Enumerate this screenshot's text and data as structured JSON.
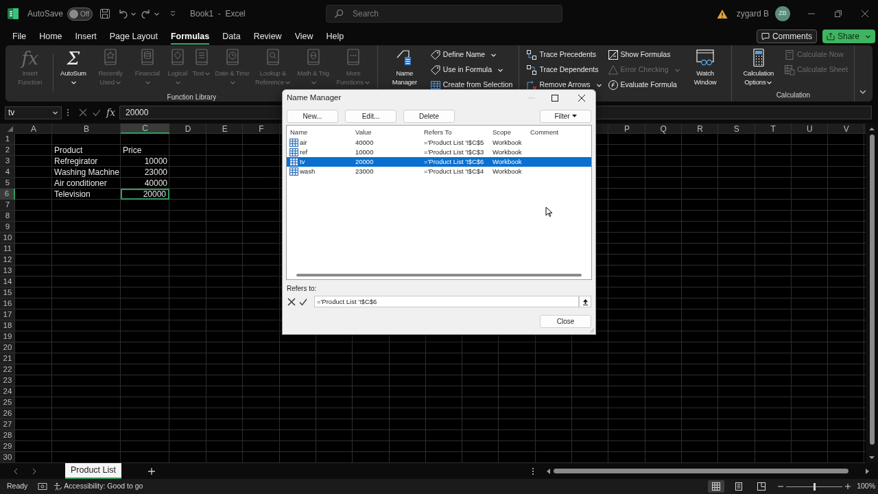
{
  "title_bar": {
    "autosave": {
      "label": "AutoSave",
      "on": false,
      "state": "Off"
    },
    "document_title": "Book1  -  Excel",
    "search": {
      "placeholder": "Search"
    },
    "user": {
      "name": "zygard B",
      "initials": "ZB"
    }
  },
  "menu": {
    "tabs": [
      {
        "label": "File",
        "selected": false
      },
      {
        "label": "Home",
        "selected": false
      },
      {
        "label": "Insert",
        "selected": false
      },
      {
        "label": "Page Layout",
        "selected": false
      },
      {
        "label": "Formulas",
        "selected": true
      },
      {
        "label": "Data",
        "selected": false
      },
      {
        "label": "Review",
        "selected": false
      },
      {
        "label": "View",
        "selected": false
      },
      {
        "label": "Help",
        "selected": false
      }
    ],
    "comments_button": "Comments",
    "share_button": "Share"
  },
  "ribbon": {
    "groups": [
      {
        "label": "Function Library",
        "items": [
          {
            "kind": "large",
            "glyph": "fx",
            "label": "Insert Function",
            "disabled": true,
            "dropdown": false
          },
          {
            "kind": "divider"
          },
          {
            "kind": "large",
            "glyph": "Σ",
            "label": "AutoSum",
            "disabled": false,
            "dropdown": true
          },
          {
            "kind": "large",
            "label": "Recently Used",
            "disabled": true,
            "dropdown": true
          },
          {
            "kind": "large",
            "label": "Financial",
            "disabled": true,
            "dropdown": true
          },
          {
            "kind": "large",
            "label": "Logical",
            "disabled": true,
            "dropdown": true
          },
          {
            "kind": "large",
            "label": "Text",
            "disabled": true,
            "dropdown": true
          },
          {
            "kind": "large",
            "label": "Date & Time",
            "disabled": true,
            "dropdown": true
          },
          {
            "kind": "large",
            "label": "Lookup & Reference",
            "disabled": true,
            "dropdown": true
          },
          {
            "kind": "large",
            "label": "Math & Trig",
            "disabled": true,
            "dropdown": true
          },
          {
            "kind": "large",
            "label": "More Functions",
            "disabled": true,
            "dropdown": true
          }
        ]
      },
      {
        "items": [
          {
            "kind": "large",
            "label": "Name Manager",
            "disabled": false,
            "dropdown": false
          },
          {
            "kind": "stack",
            "items": [
              {
                "label": "Define Name",
                "disabled": false,
                "dropdown": true
              },
              {
                "label": "Use in Formula",
                "disabled": false,
                "dropdown": true
              },
              {
                "label": "Create from Selection",
                "disabled": false,
                "dropdown": false
              }
            ]
          }
        ]
      },
      {
        "items": [
          {
            "kind": "stack",
            "items": [
              {
                "label": "Trace Precedents",
                "disabled": false,
                "dropdown": false
              },
              {
                "label": "Trace Dependents",
                "disabled": false,
                "dropdown": false
              },
              {
                "label": "Remove Arrows",
                "disabled": false,
                "dropdown": true
              }
            ]
          },
          {
            "kind": "stack",
            "items": [
              {
                "label": "Show Formulas",
                "disabled": false,
                "dropdown": false
              },
              {
                "label": "Error Checking",
                "disabled": true,
                "dropdown": true
              },
              {
                "label": "Evaluate Formula",
                "disabled": false,
                "dropdown": false
              }
            ]
          },
          {
            "kind": "large",
            "label": "Watch Window",
            "disabled": false,
            "dropdown": false
          }
        ]
      },
      {
        "label": "Calculation",
        "items": [
          {
            "kind": "large",
            "label": "Calculation Options",
            "disabled": false,
            "dropdown": true
          },
          {
            "kind": "stack",
            "items": [
              {
                "label": "Calculate Now",
                "disabled": true,
                "dropdown": false
              },
              {
                "label": "Calculate Sheet",
                "disabled": true,
                "dropdown": false
              }
            ]
          }
        ]
      }
    ]
  },
  "formula_bar": {
    "name_box": "tv",
    "glyph": "fx",
    "value": "20000"
  },
  "sheet": {
    "columns": [
      {
        "letter": "A",
        "selected": false
      },
      {
        "letter": "B",
        "selected": false
      },
      {
        "letter": "C",
        "selected": true
      },
      {
        "letter": "D",
        "selected": false
      },
      {
        "letter": "E",
        "selected": false
      },
      {
        "letter": "F",
        "selected": false
      },
      {
        "letter": "P",
        "selected": false
      },
      {
        "letter": "Q",
        "selected": false
      },
      {
        "letter": "R",
        "selected": false
      },
      {
        "letter": "S",
        "selected": false
      },
      {
        "letter": "T",
        "selected": false
      },
      {
        "letter": "U",
        "selected": false
      },
      {
        "letter": "V",
        "selected": false
      }
    ],
    "rows": [
      {
        "number": "1",
        "selected": false
      },
      {
        "number": "2",
        "selected": false,
        "cells": {
          "B": {
            "text": "Product",
            "kind": "text",
            "selected": false
          },
          "C": {
            "text": "Price",
            "kind": "text",
            "selected": false
          }
        }
      },
      {
        "number": "3",
        "selected": false,
        "cells": {
          "B": {
            "text": "Refregirator",
            "kind": "text",
            "selected": false
          },
          "C": {
            "text": "10000",
            "kind": "number",
            "selected": false
          }
        }
      },
      {
        "number": "4",
        "selected": false,
        "cells": {
          "B": {
            "text": "Washing Machine",
            "kind": "text",
            "selected": false
          },
          "C": {
            "text": "23000",
            "kind": "number",
            "selected": false
          }
        }
      },
      {
        "number": "5",
        "selected": false,
        "cells": {
          "B": {
            "text": "Air conditioner",
            "kind": "text",
            "selected": false
          },
          "C": {
            "text": "40000",
            "kind": "number",
            "selected": false
          }
        }
      },
      {
        "number": "6",
        "selected": true,
        "cells": {
          "B": {
            "text": "Television",
            "kind": "text",
            "selected": false
          },
          "C": {
            "text": "20000",
            "kind": "number",
            "selected": true
          }
        }
      },
      {
        "number": "7",
        "selected": false
      },
      {
        "number": "8",
        "selected": false
      },
      {
        "number": "9",
        "selected": false
      },
      {
        "number": "10",
        "selected": false
      },
      {
        "number": "11",
        "selected": false
      },
      {
        "number": "12",
        "selected": false
      },
      {
        "number": "13",
        "selected": false
      },
      {
        "number": "14",
        "selected": false
      },
      {
        "number": "15",
        "selected": false
      },
      {
        "number": "16",
        "selected": false
      },
      {
        "number": "17",
        "selected": false
      },
      {
        "number": "18",
        "selected": false
      },
      {
        "number": "19",
        "selected": false
      },
      {
        "number": "20",
        "selected": false
      },
      {
        "number": "21",
        "selected": false
      },
      {
        "number": "22",
        "selected": false
      },
      {
        "number": "23",
        "selected": false
      },
      {
        "number": "24",
        "selected": false
      },
      {
        "number": "25",
        "selected": false
      },
      {
        "number": "26",
        "selected": false
      },
      {
        "number": "27",
        "selected": false
      },
      {
        "number": "28",
        "selected": false
      },
      {
        "number": "29",
        "selected": false
      },
      {
        "number": "30",
        "selected": false
      }
    ]
  },
  "sheet_tabs": [
    {
      "label": "Product List",
      "selected": true
    }
  ],
  "status_bar": {
    "mode": "Ready",
    "accessibility": "Accessibility: Good to go",
    "view_buttons": [
      {
        "selected": true
      },
      {
        "selected": false
      },
      {
        "selected": false
      }
    ],
    "zoom": {
      "level": 0.5,
      "reading": "100%"
    }
  },
  "name_manager": {
    "title": "Name Manager",
    "buttons": [
      "New...",
      "Edit...",
      "Delete"
    ],
    "filter_button": "Filter",
    "columns": [
      "Name",
      "Value",
      "Refers To",
      "Scope",
      "Comment"
    ],
    "rows": [
      {
        "name": "air",
        "value": "40000",
        "refers_to": "='Product List '!$C$5",
        "scope": "Workbook",
        "selected": false
      },
      {
        "name": "ref",
        "value": "10000",
        "refers_to": "='Product List '!$C$3",
        "scope": "Workbook",
        "selected": false
      },
      {
        "name": "tv",
        "value": "20000",
        "refers_to": "='Product List '!$C$6",
        "scope": "Workbook",
        "selected": true
      },
      {
        "name": "wash",
        "value": "23000",
        "refers_to": "='Product List '!$C$4",
        "scope": "Workbook",
        "selected": false
      }
    ],
    "refers_to": {
      "label": "Refers to:",
      "value": "='Product List '!$C$6"
    },
    "close_button": "Close"
  }
}
